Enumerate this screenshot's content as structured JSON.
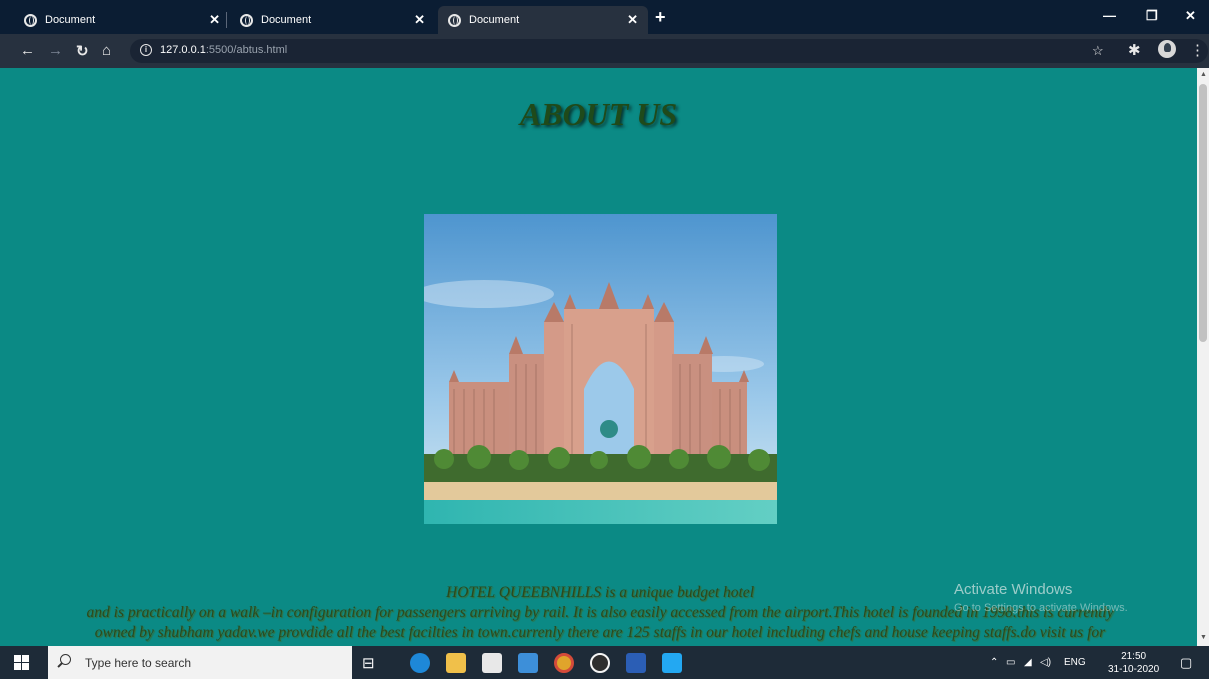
{
  "browser": {
    "tabs": [
      {
        "title": "Document"
      },
      {
        "title": "Document"
      },
      {
        "title": "Document"
      }
    ],
    "url_host": "127.0.0.1",
    "url_path": ":5500/abtus.html"
  },
  "page": {
    "heading": "ABOUT US",
    "paragraph_lines": [
      "HOTEL QUEEBNHILLS is a unique budget hotel",
      "and is practically on a walk –in configuration for passengers arriving by rail. It is also easily accessed from the airport.This hotel is founded in 1998.this is currently",
      "owned by shubham yadav.we provdide all the best facilties in town.currenly there are 125 staffs in our hotel including chefs and house keeping staffs.do visit us for"
    ],
    "watermark_title": "Activate Windows",
    "watermark_sub": "Go to Settings to activate Windows."
  },
  "taskbar": {
    "search_placeholder": "Type here to search",
    "language": "ENG",
    "time": "21:50",
    "date": "31-10-2020"
  },
  "colors": {
    "page_background": "#0b8a85",
    "heading_text": "#1f4a1a",
    "browser_frame": "#0b1d33"
  }
}
